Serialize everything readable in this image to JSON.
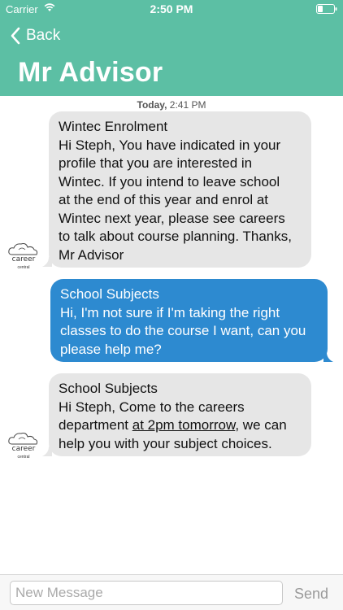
{
  "status_bar": {
    "carrier": "Carrier",
    "time": "2:50 PM",
    "wifi_icon": "wifi-icon",
    "battery_icon": "battery-icon"
  },
  "nav": {
    "back_label": "Back",
    "title": "Mr Advisor"
  },
  "timestamp": {
    "day": "Today,",
    "time": "2:41 PM"
  },
  "avatar": {
    "name": "career",
    "sub": "central"
  },
  "messages": [
    {
      "direction": "incoming",
      "lines": [
        "Wintec Enrolment",
        "Hi Steph, You have indicated in your",
        "profile that you are interested in",
        "Wintec. If you intend to leave school",
        "at the end of this year and enrol at",
        "Wintec next year, please see careers",
        "to talk about course planning. Thanks,",
        "Mr Advisor"
      ]
    },
    {
      "direction": "outgoing",
      "lines": [
        "School Subjects",
        "Hi, I'm not sure if I'm taking the right",
        "classes to do the course I want, can you",
        "please help me?"
      ]
    },
    {
      "direction": "incoming",
      "lines": [
        "School Subjects",
        "Hi Steph, Come to the careers",
        "department ",
        "at 2pm tomorrow",
        ", we can",
        "help you with your subject choices."
      ]
    }
  ],
  "input": {
    "placeholder": "New Message",
    "value": ""
  },
  "send_label": "Send",
  "colors": {
    "header": "#5cbfa4",
    "outgoing_bubble": "#2d8ad0",
    "incoming_bubble": "#e6e6e6"
  }
}
